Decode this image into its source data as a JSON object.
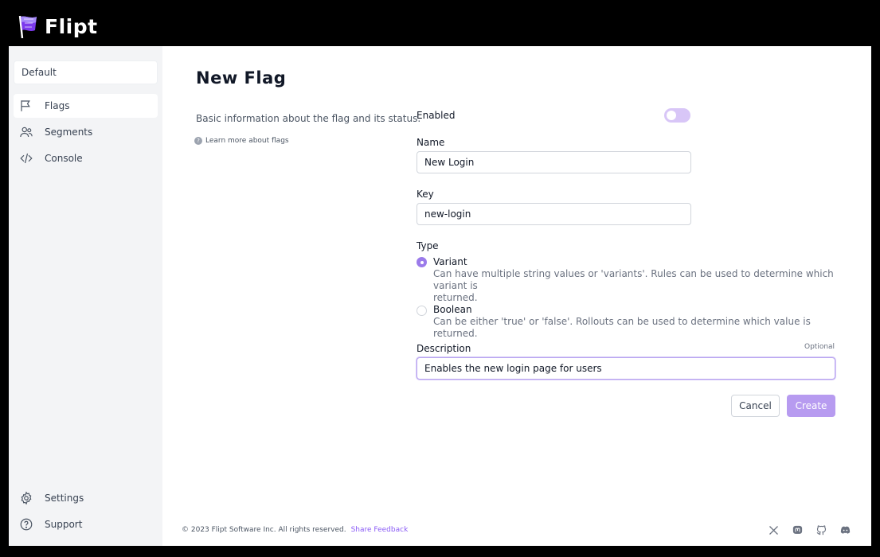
{
  "app": {
    "name": "Flipt"
  },
  "sidebar": {
    "namespace": "Default",
    "items": [
      {
        "label": "Flags",
        "icon": "flag-icon",
        "active": true
      },
      {
        "label": "Segments",
        "icon": "users-icon",
        "active": false
      },
      {
        "label": "Console",
        "icon": "code-icon",
        "active": false
      }
    ],
    "bottom_items": [
      {
        "label": "Settings",
        "icon": "gear-icon"
      },
      {
        "label": "Support",
        "icon": "question-circle-icon"
      }
    ]
  },
  "page": {
    "title": "New Flag",
    "description": "Basic information about the flag and its status.",
    "learn_more": "Learn more about flags"
  },
  "form": {
    "enabled_label": "Enabled",
    "enabled": false,
    "name_label": "Name",
    "name_value": "New Login",
    "key_label": "Key",
    "key_value": "new-login",
    "type_label": "Type",
    "types": [
      {
        "title": "Variant",
        "description": "Can have multiple string values or 'variants'. Rules can be used to determine which variant is",
        "description_wrap": "returned.",
        "selected": true
      },
      {
        "title": "Boolean",
        "description": "Can be either 'true' or 'false'. Rollouts can be used to determine which value is returned.",
        "selected": false
      }
    ],
    "description_label": "Description",
    "optional_label": "Optional",
    "description_value": "Enables the new login page for users",
    "cancel_label": "Cancel",
    "create_label": "Create"
  },
  "footer": {
    "copyright": "© 2023 Flipt Software Inc. All rights reserved.",
    "feedback": "Share Feedback",
    "social_icons": [
      "x-icon",
      "mastodon-icon",
      "github-icon",
      "discord-icon"
    ]
  },
  "colors": {
    "accent": "#9b7bea",
    "accent_light": "#b79bf0",
    "sidebar_bg": "#f3f4f6"
  }
}
